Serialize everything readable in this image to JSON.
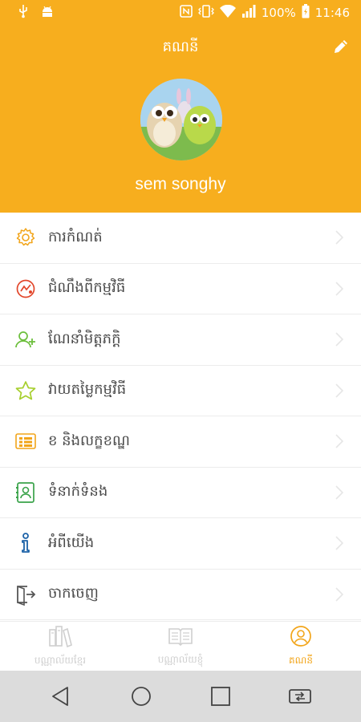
{
  "status_bar": {
    "battery": "100%",
    "time": "11:46"
  },
  "header": {
    "title": "គណនី",
    "profile_name": "sem songhy"
  },
  "menu": {
    "items": [
      {
        "label": "ការកំណត់",
        "icon": "gear-icon"
      },
      {
        "label": "ជំណឹងពីកម្មវិធី",
        "icon": "notification-icon"
      },
      {
        "label": "ណែនាំមិត្តភក្តិ",
        "icon": "add-friend-icon"
      },
      {
        "label": "វាយតម្លៃកម្មវិធី",
        "icon": "star-icon"
      },
      {
        "label": "ខ និងលក្ខខណ្ឌ",
        "icon": "terms-icon"
      },
      {
        "label": "ទំនាក់ទំនង",
        "icon": "contact-icon"
      },
      {
        "label": "អំពីយើង",
        "icon": "info-icon"
      },
      {
        "label": "ចាកចេញ",
        "icon": "logout-icon"
      }
    ]
  },
  "bottom_nav": {
    "tabs": [
      {
        "label": "បណ្ណាល័យខ្មែរ",
        "icon": "library-icon",
        "active": false
      },
      {
        "label": "បណ្ណាល័យខ្ញុំ",
        "icon": "book-icon",
        "active": false
      },
      {
        "label": "គណនី",
        "icon": "account-icon",
        "active": true
      }
    ]
  },
  "colors": {
    "primary": "#f7ae1e",
    "active_tab": "#f2a51a",
    "inactive_tab": "#cfcfcf"
  }
}
